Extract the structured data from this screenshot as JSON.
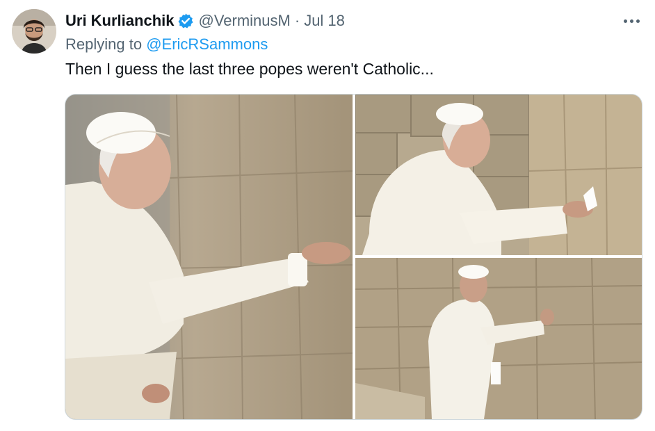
{
  "tweet": {
    "author_name": "Uri Kurlianchik",
    "handle": "@VerminusM",
    "separator": "·",
    "date": "Jul 18",
    "replying_prefix": "Replying to",
    "replying_to": "@EricRSammons",
    "text": "Then I guess the last three popes weren't Catholic...",
    "verified": true,
    "icons": {
      "verified": "verified-badge-icon",
      "more": "more-options-icon"
    },
    "colors": {
      "accent": "#1d9bf0",
      "secondary_text": "#536471",
      "primary_text": "#0f1419"
    },
    "photos": [
      "pope-at-western-wall-photo-1",
      "pope-at-western-wall-photo-2",
      "pope-at-western-wall-photo-3"
    ]
  }
}
